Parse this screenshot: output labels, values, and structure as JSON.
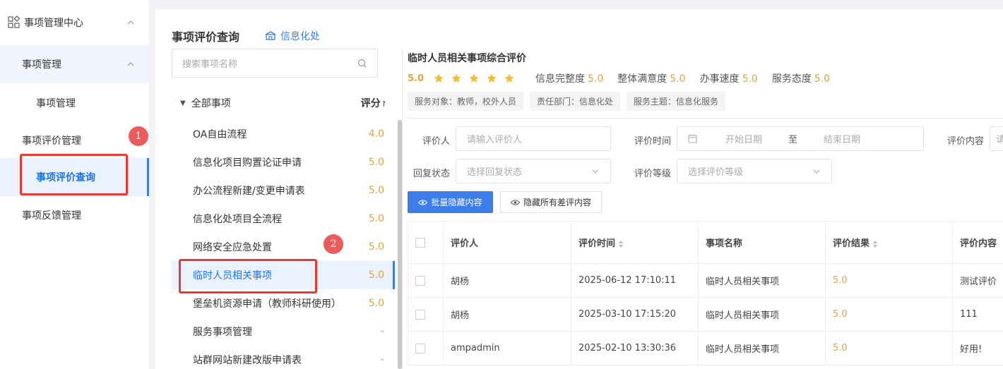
{
  "sidebar": {
    "top_title": "事项管理中心",
    "group_title": "事项管理",
    "group_item": "事项管理",
    "eval_mgmt": "事项评价管理",
    "eval_query": "事项评价查询",
    "feedback_mgmt": "事项反馈管理"
  },
  "annotations": {
    "badge1": "1",
    "badge2": "2"
  },
  "header": {
    "title": "事项评价查询",
    "dept": "信息化处"
  },
  "search": {
    "placeholder": "搜索事项名称"
  },
  "tree": {
    "root_label": "全部事项",
    "score_header": "评分",
    "items": [
      {
        "name": "OA自由流程",
        "score": "4.0"
      },
      {
        "name": "信息化项目购置论证申请",
        "score": "5.0"
      },
      {
        "name": "办公流程新建/变更申请表",
        "score": "5.0"
      },
      {
        "name": "信息化处项目全流程",
        "score": "5.0"
      },
      {
        "name": "网络安全应急处置",
        "score": "5.0"
      },
      {
        "name": "临时人员相关事项",
        "score": "5.0"
      },
      {
        "name": "堡垒机资源申请（教师科研使用）",
        "score": "5.0"
      },
      {
        "name": "服务事项管理",
        "score": "-"
      },
      {
        "name": "站群网站新建改版申请表",
        "score": "-"
      }
    ]
  },
  "detail": {
    "title": "临时人员相关事项综合评价",
    "overall": "5.0",
    "stars": 5,
    "metrics": [
      {
        "label": "信息完整度",
        "value": "5.0"
      },
      {
        "label": "整体满意度",
        "value": "5.0"
      },
      {
        "label": "办事速度",
        "value": "5.0"
      },
      {
        "label": "服务态度",
        "value": "5.0"
      }
    ],
    "tags": [
      "服务对象：教师，校外人员",
      "责任部门：信息化处",
      "服务主题：信息化服务"
    ]
  },
  "filters": {
    "evaluator_label": "评价人",
    "evaluator_placeholder": "请输入评价人",
    "time_label": "评价时间",
    "start_placeholder": "开始日期",
    "to": "至",
    "end_placeholder": "结束日期",
    "content_label": "评价内容",
    "content_placeholder": "请",
    "reply_label": "回复状态",
    "reply_placeholder": "选择回复状态",
    "level_label": "评价等级",
    "level_placeholder": "选择评价等级"
  },
  "buttons": {
    "batch_hide": "批量隐藏内容",
    "hide_bad": "隐藏所有差评内容"
  },
  "table": {
    "headers": [
      "评价人",
      "评价时间",
      "事项名称",
      "评价结果",
      "评价内容"
    ],
    "rows": [
      [
        "胡杨",
        "2025-06-12 17:10:11",
        "临时人员相关事项",
        "5.0",
        "测试评价"
      ],
      [
        "胡杨",
        "2025-03-10 17:15:20",
        "临时人员相关事项",
        "5.0",
        "111"
      ],
      [
        "ampadmin",
        "2025-02-10 13:30:36",
        "临时人员相关事项",
        "5.0",
        "好用!"
      ]
    ]
  },
  "colors": {
    "accent": "#3b7de9",
    "score": "#e6a23c",
    "annotation": "#e53935"
  }
}
